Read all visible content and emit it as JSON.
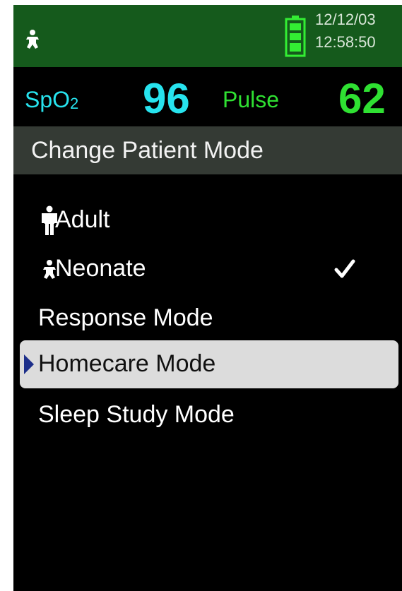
{
  "status_bar": {
    "mode_icon": "neonate-icon",
    "battery_icon": "battery-full-icon",
    "date": "12/12/03",
    "time": "12:58:50",
    "background_color": "#155a1c"
  },
  "vitals": {
    "spo2_label": "SpO",
    "spo2_subscript": "2",
    "spo2_value": "96",
    "pulse_label": "Pulse",
    "pulse_value": "62",
    "spo2_color": "#27e3ee",
    "pulse_color": "#2fe032"
  },
  "menu": {
    "title": "Change Patient Mode",
    "items": [
      {
        "label": "Adult",
        "icon": "adult-icon",
        "checked": false,
        "highlighted": false
      },
      {
        "label": "Neonate",
        "icon": "neonate-icon",
        "checked": true,
        "highlighted": false
      },
      {
        "label": "Response Mode",
        "checked": false,
        "highlighted": false
      },
      {
        "label": "Homecare Mode",
        "checked": false,
        "highlighted": true
      },
      {
        "label": "Sleep Study Mode",
        "checked": false,
        "highlighted": false
      }
    ],
    "selection_icon": "triangle-right-icon",
    "check_icon": "check-icon",
    "highlight_color": "#dcdcdc"
  }
}
